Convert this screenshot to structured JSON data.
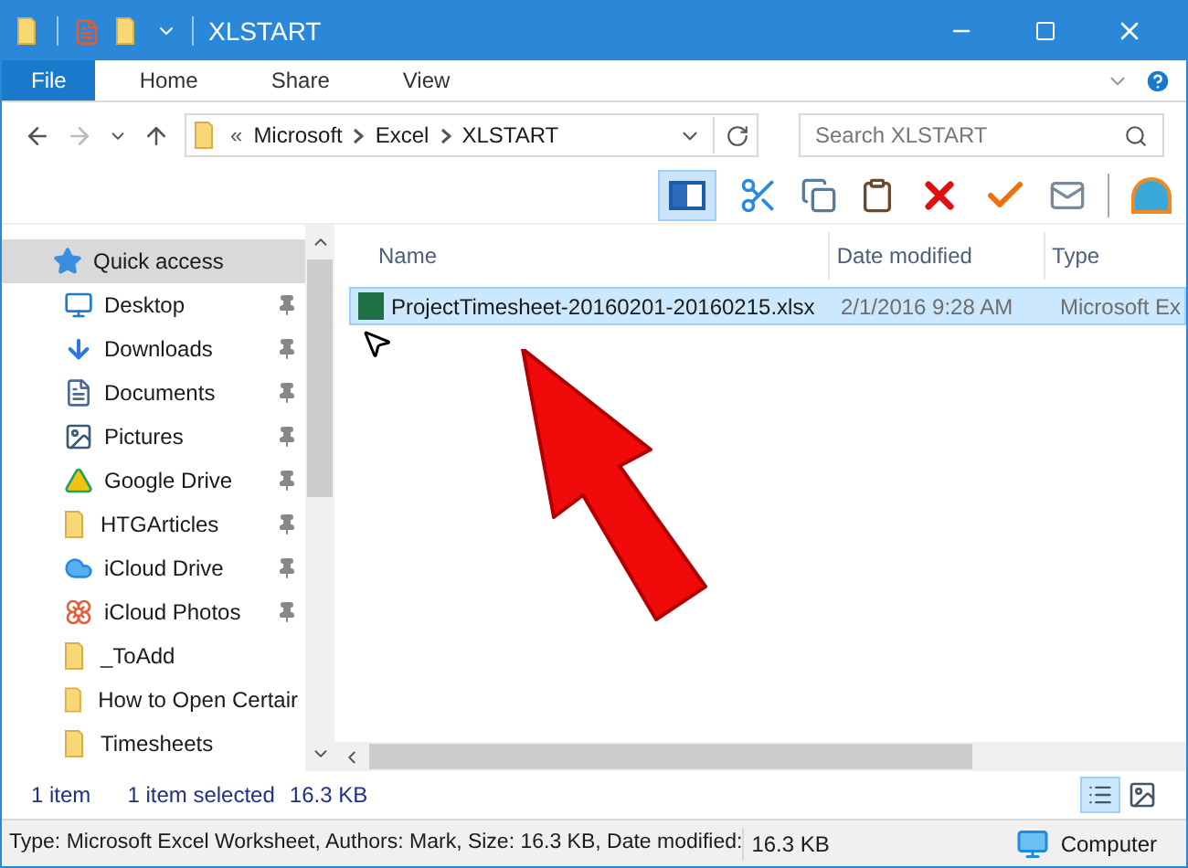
{
  "window": {
    "title": "XLSTART"
  },
  "ribbon_tabs": [
    {
      "label": "File",
      "selected": true
    },
    {
      "label": "Home",
      "selected": false
    },
    {
      "label": "Share",
      "selected": false
    },
    {
      "label": "View",
      "selected": false
    }
  ],
  "address": {
    "overflow": "«",
    "crumbs": [
      "Microsoft",
      "Excel",
      "XLSTART"
    ]
  },
  "search": {
    "placeholder": "Search XLSTART"
  },
  "sidebar": {
    "items": [
      {
        "label": "Quick access",
        "kind": "star",
        "pinned": false,
        "selected": true
      },
      {
        "label": "Desktop",
        "kind": "desktop",
        "pinned": true,
        "selected": false
      },
      {
        "label": "Downloads",
        "kind": "download",
        "pinned": true,
        "selected": false
      },
      {
        "label": "Documents",
        "kind": "document",
        "pinned": true,
        "selected": false
      },
      {
        "label": "Pictures",
        "kind": "picture",
        "pinned": true,
        "selected": false
      },
      {
        "label": "Google Drive",
        "kind": "drive",
        "pinned": true,
        "selected": false
      },
      {
        "label": "HTGArticles",
        "kind": "folder",
        "pinned": true,
        "selected": false
      },
      {
        "label": "iCloud Drive",
        "kind": "cloud",
        "pinned": true,
        "selected": false
      },
      {
        "label": "iCloud Photos",
        "kind": "photos",
        "pinned": true,
        "selected": false
      },
      {
        "label": "_ToAdd",
        "kind": "folder",
        "pinned": false,
        "selected": false
      },
      {
        "label": "How to Open Certair",
        "kind": "folder",
        "pinned": false,
        "selected": false
      },
      {
        "label": "Timesheets",
        "kind": "folder",
        "pinned": false,
        "selected": false
      }
    ]
  },
  "table": {
    "columns": [
      "Name",
      "Date modified",
      "Type"
    ],
    "rows": [
      {
        "name": "ProjectTimesheet-20160201-20160215.xlsx",
        "date": "2/1/2016 9:28 AM",
        "type": "Microsoft Ex",
        "selected": true
      }
    ]
  },
  "status_bar": {
    "count": "1 item",
    "selection": "1 item selected",
    "size": "16.3 KB"
  },
  "details_bar": {
    "info": "Type: Microsoft Excel Worksheet, Authors: Mark, Size: 16.3 KB, Date modified:",
    "size": "16.3 KB",
    "location": "Computer"
  }
}
